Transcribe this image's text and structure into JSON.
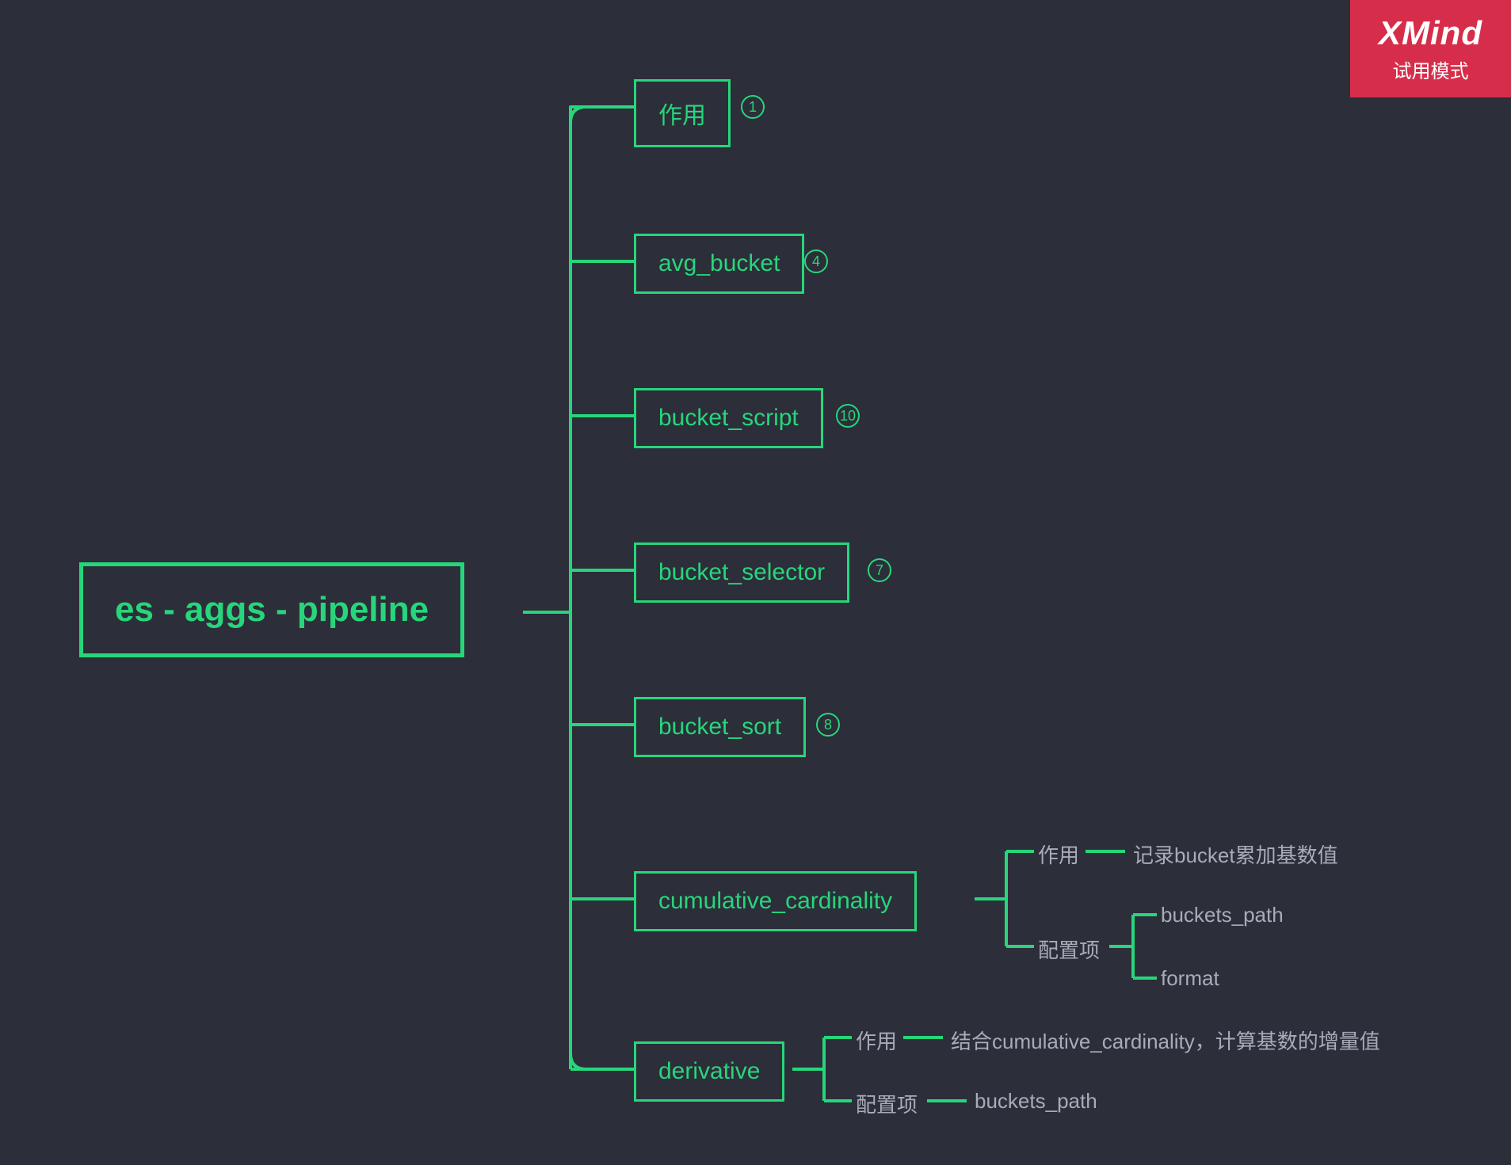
{
  "watermark": {
    "brand": "XMind",
    "mode": "试用模式"
  },
  "root": {
    "label": "es - aggs - pipeline"
  },
  "children": [
    {
      "label": "作用",
      "badge": "1"
    },
    {
      "label": "avg_bucket",
      "badge": "4"
    },
    {
      "label": "bucket_script",
      "badge": "10"
    },
    {
      "label": "bucket_selector",
      "badge": "7"
    },
    {
      "label": "bucket_sort",
      "badge": "8"
    },
    {
      "label": "cumulative_cardinality",
      "children": [
        {
          "label": "作用",
          "children": [
            {
              "label": "记录bucket累加基数值"
            }
          ]
        },
        {
          "label": "配置项",
          "children": [
            {
              "label": "buckets_path"
            },
            {
              "label": "format"
            }
          ]
        }
      ]
    },
    {
      "label": "derivative",
      "children": [
        {
          "label": "作用",
          "children": [
            {
              "label": "结合cumulative_cardinality，计算基数的增量值"
            }
          ]
        },
        {
          "label": "配置项",
          "children": [
            {
              "label": "buckets_path"
            }
          ]
        }
      ]
    }
  ]
}
